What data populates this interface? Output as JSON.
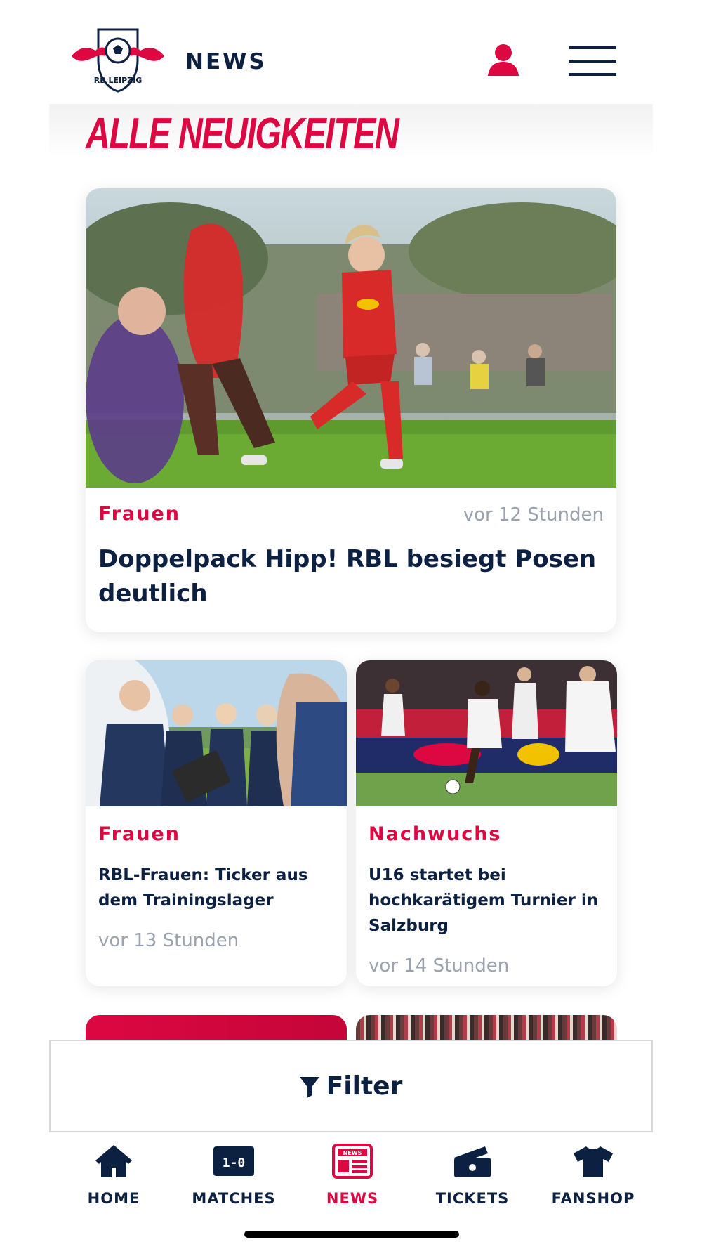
{
  "header": {
    "title": "NEWS",
    "logo_text": "RB LEIPZIG"
  },
  "page": {
    "title": "ALLE NEUIGKEITEN"
  },
  "articles": [
    {
      "category": "Frauen",
      "time": "vor 12 Stunden",
      "title": "Doppelpack Hipp! RBL besiegt Posen deutlich"
    },
    {
      "category": "Frauen",
      "title": "RBL-Frauen: Ticker aus dem Trainingslager",
      "time": "vor 13 Stunden"
    },
    {
      "category": "Nachwuchs",
      "title": "U16 startet bei hochkarätigem Turnier in Salzburg",
      "time": "vor 14 Stunden"
    }
  ],
  "filter": {
    "label": "Filter"
  },
  "tabbar": {
    "items": [
      {
        "label": "HOME",
        "icon": "home-icon"
      },
      {
        "label": "MATCHES",
        "icon": "scoreboard-icon"
      },
      {
        "label": "NEWS",
        "icon": "news-icon",
        "active": true
      },
      {
        "label": "TICKETS",
        "icon": "ticket-icon"
      },
      {
        "label": "FANSHOP",
        "icon": "shirt-icon"
      }
    ],
    "news_icon_text": "NEWS",
    "scoreboard_text": "1-0"
  },
  "colors": {
    "brand_red": "#dd0741",
    "navy": "#0c2142",
    "muted": "#9aa2ad"
  }
}
